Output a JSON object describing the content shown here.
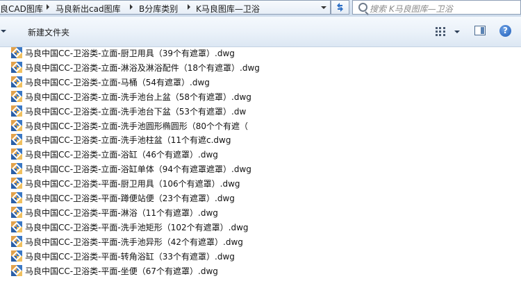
{
  "address_bar": {
    "breadcrumbs": [
      "良CAD图库",
      "马良新出cad图库",
      "B分库类别",
      "K马良图库—卫浴"
    ]
  },
  "search": {
    "placeholder": "搜索 K马良图库—卫浴"
  },
  "toolbar": {
    "new_folder_label": "新建文件夹",
    "help_label": "?"
  },
  "files": [
    {
      "name": "马良中国CC-卫浴类-立面-厨卫用具（39个有遮罩）.dwg"
    },
    {
      "name": "马良中国CC-卫浴类-立面-淋浴及淋浴配件（18个有遮罩）.dwg"
    },
    {
      "name": "马良中国CC-卫浴类-立面-马桶（54有遮罩）.dwg"
    },
    {
      "name": "马良中国CC-卫浴类-立面-洗手池台上盆（58个有遮罩）.dwg"
    },
    {
      "name": "马良中国CC-卫浴类-立面-洗手池台下盆（53个有遮罩）.dw"
    },
    {
      "name": "马良中国CC-卫浴类-立面-洗手池圆形椭圆形（80个个有遮（"
    },
    {
      "name": "马良中国CC-卫浴类-立面-洗手池柱盆（11个有遮c.dwg"
    },
    {
      "name": "马良中国CC-卫浴类-立面-浴缸（46个有遮罩）.dwg"
    },
    {
      "name": "马良中国CC-卫浴类-立面-浴缸单体（94个有遮罩遮罩）.dwg"
    },
    {
      "name": "马良中国CC-卫浴类-平面-厨卫用具（106个有遮罩）.dwg"
    },
    {
      "name": "马良中国CC-卫浴类-平面-蹲便站便（23个有遮罩）.dwg"
    },
    {
      "name": "马良中国CC-卫浴类-平面-淋浴（11个有遮罩）.dwg"
    },
    {
      "name": "马良中国CC-卫浴类-平面-洗手池矩形（102个有遮罩）.dwg"
    },
    {
      "name": "马良中国CC-卫浴类-平面-洗手池异形（42个有遮罩）.dwg"
    },
    {
      "name": "马良中国CC-卫浴类-平面-转角浴缸（33个有遮罩）.dwg"
    },
    {
      "name": "马良中国CC-卫浴类-平面-坐便（67个有遮罩）.dwg"
    }
  ]
}
